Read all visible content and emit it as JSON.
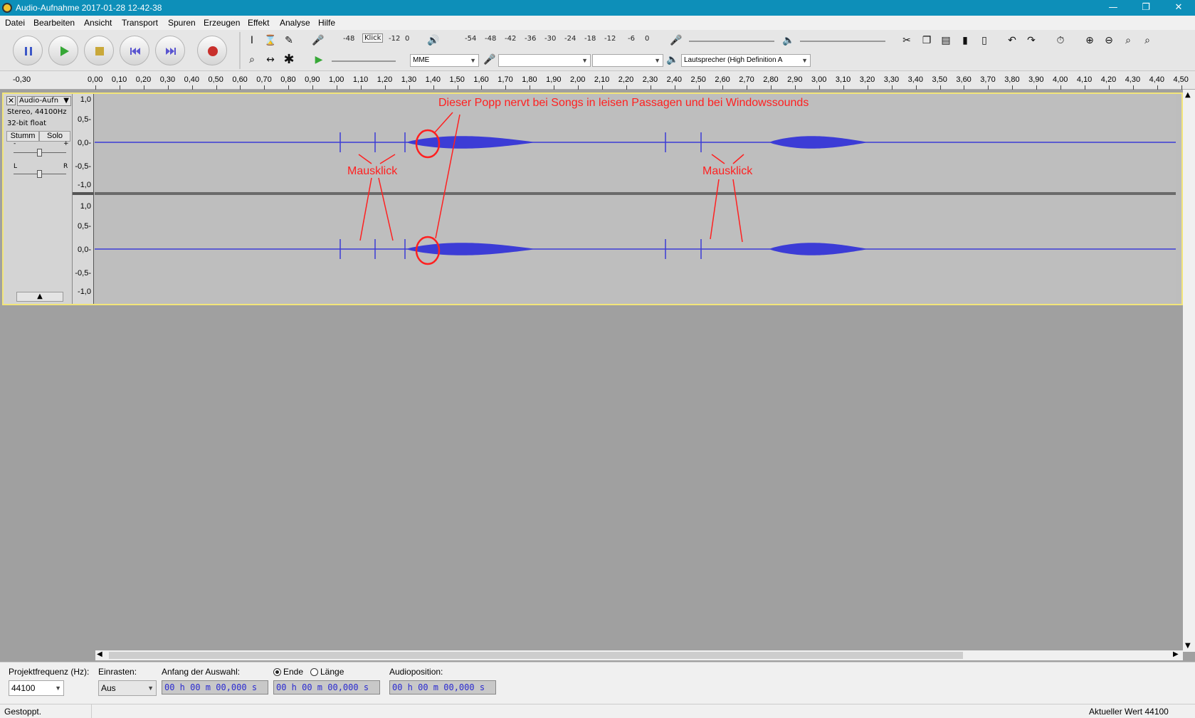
{
  "window": {
    "title": "Audio-Aufnahme 2017-01-28 12-42-38"
  },
  "menu": [
    "Datei",
    "Bearbeiten",
    "Ansicht",
    "Transport",
    "Spuren",
    "Erzeugen",
    "Effekt",
    "Analyse",
    "Hilfe"
  ],
  "toolbar": {
    "meter_record_scale": [
      "-48",
      "Klick",
      "-12",
      "0"
    ],
    "meter_play_scale": [
      "-54",
      "-48",
      "-42",
      "-36",
      "-30",
      "-24",
      "-18",
      "-12",
      "-6",
      "0"
    ],
    "host": "MME",
    "output_device": "Lautsprecher (High Definition A"
  },
  "ruler": {
    "labels": [
      "-0,30",
      "0,00",
      "0,10",
      "0,20",
      "0,30",
      "0,40",
      "0,50",
      "0,60",
      "0,70",
      "0,80",
      "0,90",
      "1,00",
      "1,10",
      "1,20",
      "1,30",
      "1,40",
      "1,50",
      "1,60",
      "1,70",
      "1,80",
      "1,90",
      "2,00",
      "2,10",
      "2,20",
      "2,30",
      "2,40",
      "2,50",
      "2,60",
      "2,70",
      "2,80",
      "2,90",
      "3,00",
      "3,10",
      "3,20",
      "3,30",
      "3,40",
      "3,50",
      "3,60",
      "3,70",
      "3,80",
      "3,90",
      "4,00",
      "4,10",
      "4,20",
      "4,30",
      "4,40",
      "4,50"
    ]
  },
  "track": {
    "name": "Audio-Aufn",
    "info1": "Stereo, 44100Hz",
    "info2": "32-bit float",
    "mute": "Stumm",
    "solo": "Solo",
    "gain_minus": "-",
    "gain_plus": "+",
    "pan_l": "L",
    "pan_r": "R",
    "scale": [
      "1,0",
      "0,5-",
      "0,0-",
      "-0,5-",
      "-1,0"
    ]
  },
  "annotations": {
    "popp": "Dieser Popp nervt bei Songs in leisen Passagen und bei Windowssounds",
    "klick1": "Mausklick",
    "klick2": "Mausklick",
    "color": "#ff2020"
  },
  "bottom": {
    "rate_label": "Projektfrequenz (Hz):",
    "rate_value": "44100",
    "snap_label": "Einrasten:",
    "snap_value": "Aus",
    "sel_start_label": "Anfang der Auswahl:",
    "end_label": "Ende",
    "length_label": "Länge",
    "pos_label": "Audioposition:",
    "time1": "00 h 00 m 00,000 s",
    "time2": "00 h 00 m 00,000 s",
    "time3": "00 h 00 m 00,000 s"
  },
  "status": {
    "left": "Gestoppt.",
    "right": "Aktueller Wert 44100"
  },
  "colors": {
    "waveform": "#3c3cd6",
    "titlebar": "#0d8fb9"
  }
}
